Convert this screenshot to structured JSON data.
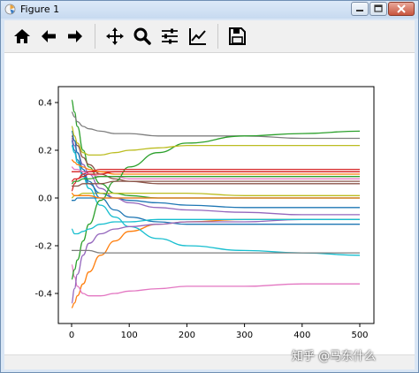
{
  "window": {
    "title": "Figure 1"
  },
  "toolbar": {
    "buttons": [
      {
        "icon": "home-icon"
      },
      {
        "icon": "back-arrow-icon"
      },
      {
        "icon": "forward-arrow-icon"
      },
      {
        "icon": "pan-move-icon"
      },
      {
        "icon": "zoom-magnifier-icon"
      },
      {
        "icon": "subplots-sliders-icon"
      },
      {
        "icon": "edit-axis-chart-icon"
      },
      {
        "icon": "save-floppy-icon"
      }
    ]
  },
  "watermark": "知乎 @马东什么",
  "chart_data": {
    "type": "line",
    "xlim": [
      0,
      500
    ],
    "ylim": [
      -0.45,
      0.45
    ],
    "xticks": [
      "0",
      "100",
      "200",
      "300",
      "400",
      "500"
    ],
    "yticks": [
      "-0.4",
      "-0.2",
      "0.0",
      "0.2",
      "0.4"
    ],
    "x": [
      0,
      5,
      10,
      20,
      30,
      50,
      75,
      100,
      150,
      200,
      300,
      400,
      500
    ],
    "series": [
      {
        "color": "#1f77b4",
        "values": [
          0.24,
          0.2,
          0.16,
          0.1,
          0.06,
          0.02,
          0.0,
          -0.01,
          -0.02,
          -0.03,
          -0.04,
          -0.04,
          -0.04
        ]
      },
      {
        "color": "#ff7f0e",
        "values": [
          -0.46,
          -0.44,
          -0.41,
          -0.36,
          -0.31,
          -0.24,
          -0.18,
          -0.14,
          -0.11,
          -0.1,
          -0.09,
          -0.09,
          -0.09
        ]
      },
      {
        "color": "#2ca02c",
        "values": [
          0.41,
          0.36,
          0.3,
          0.2,
          0.13,
          0.06,
          0.02,
          0.01,
          0.0,
          0.0,
          0.0,
          0.0,
          0.0
        ]
      },
      {
        "color": "#d62728",
        "values": [
          0.11,
          0.11,
          0.11,
          0.11,
          0.11,
          0.11,
          0.11,
          0.11,
          0.11,
          0.11,
          0.11,
          0.11,
          0.11
        ]
      },
      {
        "color": "#9467bd",
        "values": [
          0.25,
          0.22,
          0.19,
          0.14,
          0.1,
          0.04,
          0.0,
          -0.02,
          -0.04,
          -0.05,
          -0.06,
          -0.07,
          -0.07
        ]
      },
      {
        "color": "#8c564b",
        "values": [
          0.26,
          0.24,
          0.22,
          0.17,
          0.14,
          0.1,
          0.08,
          0.07,
          0.06,
          0.06,
          0.06,
          0.06,
          0.06
        ]
      },
      {
        "color": "#e377c2",
        "values": [
          -0.28,
          -0.33,
          -0.37,
          -0.4,
          -0.41,
          -0.41,
          -0.4,
          -0.39,
          -0.38,
          -0.37,
          -0.37,
          -0.36,
          -0.36
        ]
      },
      {
        "color": "#7f7f7f",
        "values": [
          0.36,
          0.34,
          0.32,
          0.3,
          0.29,
          0.28,
          0.27,
          0.27,
          0.26,
          0.26,
          0.26,
          0.25,
          0.25
        ]
      },
      {
        "color": "#bcbd22",
        "values": [
          0.0,
          0.01,
          0.01,
          0.02,
          0.02,
          0.02,
          0.02,
          0.02,
          0.02,
          0.02,
          0.01,
          0.01,
          0.01
        ]
      },
      {
        "color": "#17becf",
        "values": [
          0.22,
          0.19,
          0.15,
          0.09,
          0.04,
          -0.03,
          -0.08,
          -0.12,
          -0.17,
          -0.2,
          -0.22,
          -0.23,
          -0.24
        ]
      },
      {
        "color": "#1f77b4",
        "values": [
          0.28,
          0.24,
          0.19,
          0.12,
          0.07,
          0.0,
          -0.05,
          -0.08,
          -0.1,
          -0.11,
          -0.11,
          -0.11,
          -0.11
        ]
      },
      {
        "color": "#ff7f0e",
        "values": [
          0.16,
          0.15,
          0.14,
          0.13,
          0.12,
          0.11,
          0.1,
          0.1,
          0.1,
          0.1,
          0.1,
          0.1,
          0.1
        ]
      },
      {
        "color": "#2ca02c",
        "values": [
          -0.34,
          -0.3,
          -0.26,
          -0.18,
          -0.11,
          -0.01,
          0.07,
          0.13,
          0.19,
          0.23,
          0.26,
          0.27,
          0.28
        ]
      },
      {
        "color": "#d62728",
        "values": [
          0.03,
          0.06,
          0.08,
          0.1,
          0.11,
          0.12,
          0.12,
          0.12,
          0.12,
          0.12,
          0.12,
          0.12,
          0.12
        ]
      },
      {
        "color": "#9467bd",
        "values": [
          -0.44,
          -0.38,
          -0.32,
          -0.24,
          -0.19,
          -0.15,
          -0.13,
          -0.12,
          -0.11,
          -0.1,
          -0.1,
          -0.09,
          -0.09
        ]
      },
      {
        "color": "#8c564b",
        "values": [
          0.05,
          0.05,
          0.05,
          0.06,
          0.06,
          0.06,
          0.07,
          0.07,
          0.07,
          0.07,
          0.07,
          0.07,
          0.07
        ]
      },
      {
        "color": "#e377c2",
        "values": [
          0.13,
          0.12,
          0.12,
          0.11,
          0.1,
          0.09,
          0.09,
          0.08,
          0.08,
          0.08,
          0.08,
          0.08,
          0.08
        ]
      },
      {
        "color": "#7f7f7f",
        "values": [
          -0.22,
          -0.22,
          -0.22,
          -0.22,
          -0.22,
          -0.23,
          -0.23,
          -0.23,
          -0.23,
          -0.23,
          -0.23,
          -0.23,
          -0.23
        ]
      },
      {
        "color": "#bcbd22",
        "values": [
          0.3,
          0.26,
          0.23,
          0.19,
          0.18,
          0.18,
          0.19,
          0.2,
          0.21,
          0.22,
          0.22,
          0.22,
          0.22
        ]
      },
      {
        "color": "#17becf",
        "values": [
          -0.13,
          -0.15,
          -0.15,
          -0.14,
          -0.13,
          -0.11,
          -0.1,
          -0.1,
          -0.09,
          -0.09,
          -0.09,
          -0.09,
          -0.09
        ]
      },
      {
        "color": "#1f77b4",
        "values": [
          -0.01,
          -0.01,
          0.0,
          0.0,
          0.0,
          0.0,
          0.0,
          0.0,
          0.0,
          0.0,
          0.0,
          0.0,
          0.0
        ]
      },
      {
        "color": "#ff7f0e",
        "values": [
          0.02,
          0.01,
          0.01,
          0.01,
          0.01,
          0.0,
          0.0,
          0.0,
          0.0,
          0.0,
          0.0,
          0.0,
          0.0
        ]
      },
      {
        "color": "#2ca02c",
        "values": [
          0.06,
          0.07,
          0.07,
          0.08,
          0.08,
          0.09,
          0.09,
          0.09,
          0.09,
          0.09,
          0.09,
          0.09,
          0.09
        ]
      },
      {
        "color": "#d62728",
        "values": [
          0.07,
          0.08,
          0.08,
          0.09,
          0.1,
          0.1,
          0.11,
          0.11,
          0.11,
          0.11,
          0.11,
          0.11,
          0.11
        ]
      }
    ]
  }
}
